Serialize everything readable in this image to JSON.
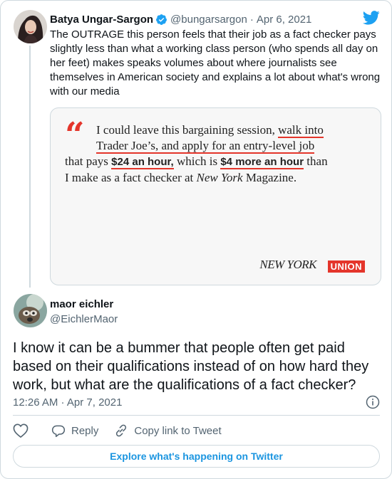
{
  "parent_tweet": {
    "author_name": "Batya Ungar-Sargon",
    "handle": "@bungarsargon",
    "separator": "·",
    "date": "Apr 6, 2021",
    "text": "The OUTRAGE this person feels that their job as a fact checker pays slightly less than what a working class person (who spends all day on her feet) makes speaks volumes about where journalists see themselves in American society and explains a lot about what's wrong with our media",
    "quote_image": {
      "mark": "“",
      "line1_a": "I could leave this bargaining session, ",
      "line1_u": "walk into",
      "line2_u": "Trader Joe’s, and apply for an entry-level job",
      "line3_a": "that pays ",
      "line3_b1": "$24 an hour,",
      "line3_c": " which is ",
      "line3_b2": "$4 more an hour",
      "line3_d": " than",
      "line4_a": "I make as a fact checker at ",
      "line4_i": "New York",
      "line4_b": " Magazine.",
      "logo_text": "NEW YORK",
      "badge_text": "UNION"
    }
  },
  "reply_tweet": {
    "author_name": "maor eichler",
    "handle": "@EichlerMaor",
    "text": "I know it can be a bummer that people often get paid based on their qualifications instead of on how hard they work, but what are the qualifications of a fact checker?",
    "timestamp": "12:26 AM · Apr 7, 2021"
  },
  "actions": {
    "reply_label": "Reply",
    "copy_link_label": "Copy link to Tweet"
  },
  "explore_label": "Explore what's happening on Twitter",
  "colors": {
    "twitter_blue": "#1da1f2",
    "link_blue": "#1b95e0",
    "accent_red": "#e4352b",
    "secondary_text": "#536471",
    "border": "#cfd9de"
  },
  "icons": [
    "verified-badge-icon",
    "twitter-bird-icon",
    "info-icon",
    "heart-icon",
    "reply-icon",
    "link-icon"
  ]
}
